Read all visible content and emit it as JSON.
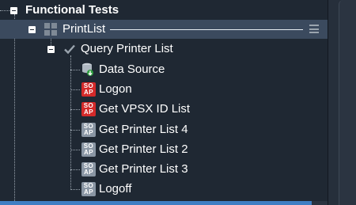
{
  "tree": {
    "root": {
      "label": "Functional Tests",
      "icon": "minus-toggle-icon"
    },
    "testcase": {
      "label": "PrintList",
      "icon": "grid-icon",
      "menu_icon": "hamburger-menu-icon"
    },
    "step": {
      "label": "Query Printer List",
      "icon": "checkmark-icon"
    },
    "items": [
      {
        "label": "Data Source",
        "icon": "database-icon"
      },
      {
        "label": "Logon",
        "icon": "soap-icon",
        "badge_top": "SO",
        "badge_bottom": "AP",
        "color": "#d42a2a"
      },
      {
        "label": "Get VPSX ID List",
        "icon": "soap-icon",
        "badge_top": "SO",
        "badge_bottom": "AP",
        "color": "#d42a2a"
      },
      {
        "label": "Get Printer List 4",
        "icon": "soap-icon",
        "badge_top": "SO",
        "badge_bottom": "AP",
        "color": "#8a96a4"
      },
      {
        "label": "Get Printer List 2",
        "icon": "soap-icon",
        "badge_top": "SO",
        "badge_bottom": "AP",
        "color": "#8a96a4"
      },
      {
        "label": "Get Printer List 3",
        "icon": "soap-icon",
        "badge_top": "SO",
        "badge_bottom": "AP",
        "color": "#8a96a4"
      },
      {
        "label": "Logoff",
        "icon": "soap-icon",
        "badge_top": "SO",
        "badge_bottom": "AP",
        "color": "#8a96a4"
      }
    ]
  },
  "colors": {
    "background": "#1f2833",
    "selected_row": "#3b4a5e",
    "accent_bar": "#3f7ec3",
    "soap_error": "#d42a2a",
    "soap_normal": "#8a96a4"
  }
}
